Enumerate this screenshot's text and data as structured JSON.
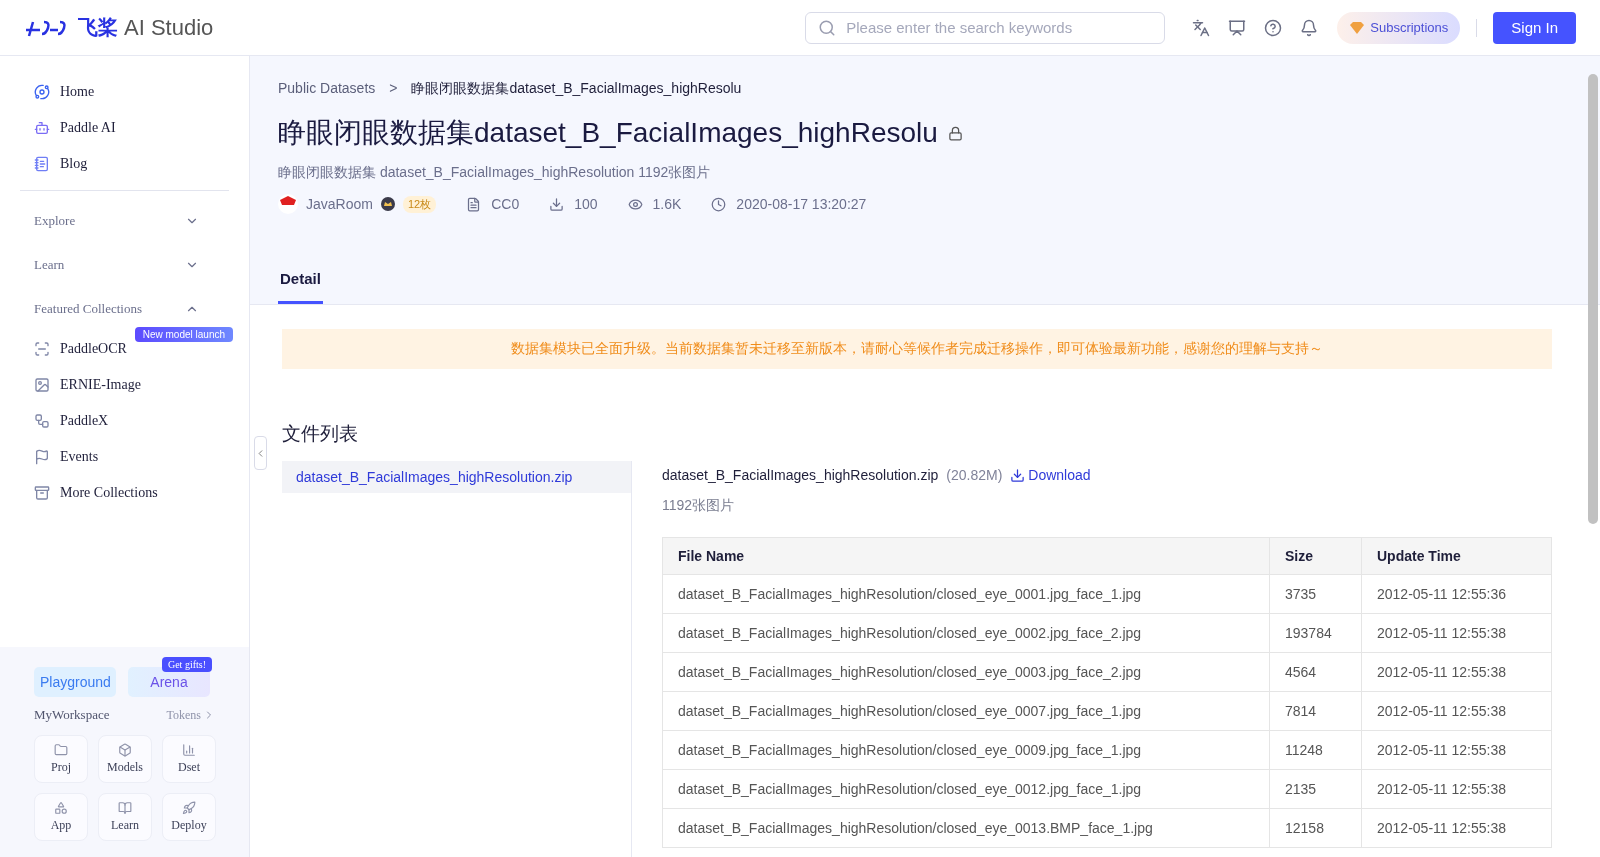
{
  "header": {
    "logo_text": "飞桨",
    "product": "AI Studio",
    "search": {
      "placeholder": "Please enter the search keywords"
    },
    "subscriptions": "Subscriptions",
    "sign_in": "Sign In"
  },
  "sidebar": {
    "items": [
      {
        "kind": "link",
        "label": "Home"
      },
      {
        "kind": "link",
        "label": "Paddle AI"
      },
      {
        "kind": "link",
        "label": "Blog"
      },
      {
        "kind": "divider"
      },
      {
        "kind": "section",
        "label": "Explore",
        "expanded": false
      },
      {
        "kind": "section",
        "label": "Learn",
        "expanded": false
      },
      {
        "kind": "section",
        "label": "Featured Collections",
        "expanded": true,
        "children": [
          {
            "label": "PaddleOCR",
            "badge": "New model launch"
          },
          {
            "label": "ERNIE-Image"
          },
          {
            "label": "PaddleX"
          },
          {
            "label": "Events"
          },
          {
            "label": "More Collections"
          }
        ]
      }
    ],
    "bottom": {
      "playground": "Playground",
      "arena": "Arena",
      "arena_badge": "Get gifts!",
      "workspace": "MyWorkspace",
      "tokens": "Tokens",
      "tiles": [
        {
          "label": "Proj"
        },
        {
          "label": "Models"
        },
        {
          "label": "Dset"
        },
        {
          "label": "App"
        },
        {
          "label": "Learn"
        },
        {
          "label": "Deploy"
        }
      ]
    }
  },
  "breadcrumb": [
    "Public Datasets",
    "睁眼闭眼数据集dataset_B_FacialImages_highResolu"
  ],
  "breadcrumb_separator": ">",
  "title": "睁眼闭眼数据集dataset_B_FacialImages_highResolu",
  "subtitle": "睁眼闭眼数据集 dataset_B_FacialImages_highResolution 1192张图片",
  "meta": {
    "author": "JavaRoom",
    "medal": "12枚",
    "license": "CC0",
    "downloads": "100",
    "views": "1.6K",
    "date": "2020-08-17 13:20:27"
  },
  "tabs": [
    {
      "label": "Detail",
      "selected": true
    }
  ],
  "notice": "数据集模块已全面升级。当前数据集暂未迁移至新版本，请耐心等候作者完成迁移操作，即可体验最新功能，感谢您的理解与支持～",
  "file_list": {
    "heading": "文件列表",
    "files": [
      {
        "name": "dataset_B_FacialImages_highResolution.zip",
        "selected": true
      }
    ]
  },
  "file_detail": {
    "name": "dataset_B_FacialImages_highResolution.zip",
    "size": "(20.82M)",
    "download": "Download",
    "description": "1192张图片"
  },
  "table": {
    "columns": [
      "File Name",
      "Size",
      "Update Time"
    ],
    "rows": [
      [
        "dataset_B_FacialImages_highResolution/closed_eye_0001.jpg_face_1.jpg",
        "3735",
        "2012-05-11 12:55:36"
      ],
      [
        "dataset_B_FacialImages_highResolution/closed_eye_0002.jpg_face_2.jpg",
        "193784",
        "2012-05-11 12:55:38"
      ],
      [
        "dataset_B_FacialImages_highResolution/closed_eye_0003.jpg_face_2.jpg",
        "4564",
        "2012-05-11 12:55:38"
      ],
      [
        "dataset_B_FacialImages_highResolution/closed_eye_0007.jpg_face_1.jpg",
        "7814",
        "2012-05-11 12:55:38"
      ],
      [
        "dataset_B_FacialImages_highResolution/closed_eye_0009.jpg_face_1.jpg",
        "11248",
        "2012-05-11 12:55:38"
      ],
      [
        "dataset_B_FacialImages_highResolution/closed_eye_0012.jpg_face_1.jpg",
        "2135",
        "2012-05-11 12:55:38"
      ],
      [
        "dataset_B_FacialImages_highResolution/closed_eye_0013.BMP_face_1.jpg",
        "12158",
        "2012-05-11 12:55:38"
      ]
    ]
  }
}
